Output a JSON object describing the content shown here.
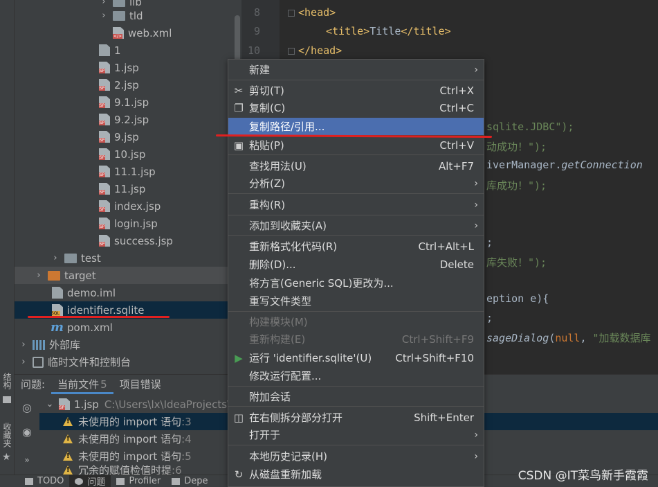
{
  "project_tree": {
    "rows": [
      {
        "label": "lib",
        "type": "folder",
        "arrow": "›"
      },
      {
        "label": "tld",
        "type": "folder",
        "arrow": "›"
      },
      {
        "label": "web.xml",
        "type": "xml"
      },
      {
        "label": "1",
        "type": "file"
      },
      {
        "label": "1.jsp",
        "type": "jsp"
      },
      {
        "label": "2.jsp",
        "type": "jsp"
      },
      {
        "label": "9.1.jsp",
        "type": "jsp"
      },
      {
        "label": "9.2.jsp",
        "type": "jsp"
      },
      {
        "label": "9.jsp",
        "type": "jsp"
      },
      {
        "label": "10.jsp",
        "type": "jsp"
      },
      {
        "label": "11.1.jsp",
        "type": "jsp"
      },
      {
        "label": "11.jsp",
        "type": "jsp"
      },
      {
        "label": "index.jsp",
        "type": "jsp"
      },
      {
        "label": "login.jsp",
        "type": "jsp"
      },
      {
        "label": "success.jsp",
        "type": "jsp"
      },
      {
        "label": "test",
        "type": "folder",
        "arrow": "›"
      },
      {
        "label": "target",
        "type": "folder-orange",
        "arrow": "›"
      },
      {
        "label": "demo.iml",
        "type": "file"
      },
      {
        "label": "identifier.sqlite",
        "type": "sql"
      },
      {
        "label": "pom.xml",
        "type": "maven"
      },
      {
        "label": "外部库",
        "type": "lib",
        "arrow": "›"
      },
      {
        "label": "临时文件和控制台",
        "type": "tmp",
        "arrow": "›"
      }
    ]
  },
  "left_strip": {
    "structure_label": "结构",
    "favorites_label": "收藏夹"
  },
  "editor": {
    "line_numbers": [
      "8",
      "9",
      "10"
    ],
    "lines": {
      "l8_tag": "<head>",
      "l9_open": "<title>",
      "l9_text": "Title",
      "l9_close": "</title>",
      "l10_tag": "</head>",
      "frag1": "sqlite.JDBC\");",
      "frag2": "动成功！\");",
      "frag3_plain": "iverManager.",
      "frag3_italic": "getConnection",
      "frag4": "库成功！\");",
      "frag5": ";",
      "frag6": "库失败！\");",
      "frag7": "eption e){",
      "frag8": ";",
      "frag9_italic": "sageDialog",
      "frag9_plain": "(",
      "frag9_kw": "null",
      "frag9_sep": ", ",
      "frag9_str": "\"加载数据库"
    }
  },
  "problems": {
    "tabs": [
      {
        "label": "问题:"
      },
      {
        "label": "当前文件",
        "count": "5"
      },
      {
        "label": "项目错误"
      }
    ],
    "file_label": "1.jsp",
    "file_path": "C:\\Users\\lx\\IdeaProjects\\de",
    "items": [
      {
        "text": "未使用的 import 语句",
        "line": ":3"
      },
      {
        "text": "未使用的 import 语句",
        "line": ":4"
      },
      {
        "text": "未使用的 import 语句",
        "line": ":5"
      },
      {
        "text": "冗余的赋值检值时提",
        "line": ":6"
      }
    ]
  },
  "status_bar": {
    "buttons": [
      "TODO",
      "问题",
      "Profiler",
      "Depe"
    ]
  },
  "watermark": "CSDN @IT菜鸟新手霞霞",
  "context_menu": {
    "items": [
      {
        "label": "新建",
        "submenu": true
      },
      {
        "label": "剪切(T)",
        "shortcut": "Ctrl+X",
        "icon": "cut-icon"
      },
      {
        "label": "复制(C)",
        "shortcut": "Ctrl+C",
        "icon": "copy-icon"
      },
      {
        "label": "复制路径/引用...",
        "highlighted": true
      },
      {
        "label": "粘贴(P)",
        "shortcut": "Ctrl+V",
        "icon": "paste-icon"
      },
      {
        "label": "查找用法(U)",
        "shortcut": "Alt+F7"
      },
      {
        "label": "分析(Z)",
        "submenu": true
      },
      {
        "label": "重构(R)",
        "submenu": true
      },
      {
        "label": "添加到收藏夹(A)",
        "submenu": true
      },
      {
        "label": "重新格式化代码(R)",
        "shortcut": "Ctrl+Alt+L"
      },
      {
        "label": "删除(D)...",
        "shortcut": "Delete"
      },
      {
        "label": "将方言(Generic SQL)更改为..."
      },
      {
        "label": "重写文件类型"
      },
      {
        "label": "构建模块(M)",
        "disabled": true
      },
      {
        "label": "重新构建(E)",
        "shortcut": "Ctrl+Shift+F9",
        "disabled": true
      },
      {
        "label": "运行 'identifier.sqlite'(U)",
        "shortcut": "Ctrl+Shift+F10",
        "icon": "run-icon"
      },
      {
        "label": "修改运行配置..."
      },
      {
        "label": "附加会话"
      },
      {
        "label": "在右侧拆分部分打开",
        "shortcut": "Shift+Enter",
        "icon": "split-icon"
      },
      {
        "label": "打开于",
        "submenu": true
      },
      {
        "label": "本地历史记录(H)",
        "submenu": true
      },
      {
        "label": "从磁盘重新加载",
        "icon": "reload-icon"
      }
    ]
  }
}
